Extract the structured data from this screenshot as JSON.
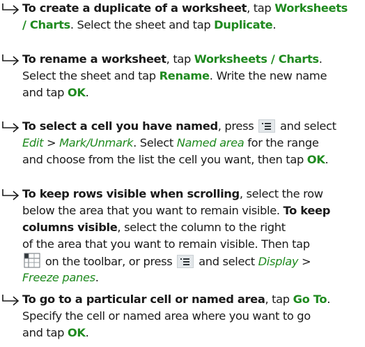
{
  "items": [
    {
      "lines": [
        [
          {
            "t": "To create a duplicate of a worksheet",
            "s": "b"
          },
          {
            "t": ", tap "
          },
          {
            "t": "Worksheets",
            "s": "g"
          }
        ],
        [
          {
            "t": "/ Charts",
            "s": "g"
          },
          {
            "t": ". Select the sheet and tap "
          },
          {
            "t": "Duplicate",
            "s": "g"
          },
          {
            "t": "."
          }
        ]
      ]
    },
    {
      "lines": [
        [
          {
            "t": "To rename a worksheet",
            "s": "b"
          },
          {
            "t": ", tap "
          },
          {
            "t": "Worksheets / Charts",
            "s": "g"
          },
          {
            "t": "."
          }
        ],
        [
          {
            "t": "Select the sheet and tap "
          },
          {
            "t": "Rename",
            "s": "g"
          },
          {
            "t": ". Write the new name"
          }
        ],
        [
          {
            "t": "and tap "
          },
          {
            "t": "OK",
            "s": "g"
          },
          {
            "t": "."
          }
        ]
      ]
    },
    {
      "lines": [
        [
          {
            "t": "To select a cell you have named",
            "s": "b"
          },
          {
            "t": ", press "
          },
          {
            "icon": "menu-icon"
          },
          {
            "t": " and select"
          }
        ],
        [
          {
            "t": "Edit",
            "s": "gi"
          },
          {
            "t": " > "
          },
          {
            "t": "Mark/Unmark",
            "s": "gi"
          },
          {
            "t": ". Select "
          },
          {
            "t": "Named area",
            "s": "gi"
          },
          {
            "t": " for the range"
          }
        ],
        [
          {
            "t": "and choose from the list the cell you want, then tap "
          },
          {
            "t": "OK",
            "s": "g"
          },
          {
            "t": "."
          }
        ]
      ]
    },
    {
      "lines": [
        [
          {
            "t": "To keep rows visible when scrolling",
            "s": "b"
          },
          {
            "t": ", select the row"
          }
        ],
        [
          {
            "t": "below the area that you want to remain visible. "
          },
          {
            "t": "To keep",
            "s": "b"
          }
        ],
        [
          {
            "t": "columns visible",
            "s": "b"
          },
          {
            "t": ", select the column to the right"
          }
        ],
        [
          {
            "t": "of the area that you want to remain visible. Then tap"
          }
        ],
        [
          {
            "icon": "freeze-panes-icon"
          },
          {
            "t": " on the toolbar, or press "
          },
          {
            "icon": "menu-icon"
          },
          {
            "t": " and select "
          },
          {
            "t": "Display",
            "s": "gi"
          },
          {
            "t": " >"
          }
        ],
        [
          {
            "t": "Freeze panes",
            "s": "gi"
          },
          {
            "t": "."
          }
        ]
      ]
    },
    {
      "lines": [
        [
          {
            "t": "To go to a particular cell or named area",
            "s": "b"
          },
          {
            "t": ", tap "
          },
          {
            "t": "Go To",
            "s": "g"
          },
          {
            "t": "."
          }
        ],
        [
          {
            "t": "Specify the cell or named area where you want to go"
          }
        ],
        [
          {
            "t": "and tap "
          },
          {
            "t": "OK",
            "s": "g"
          },
          {
            "t": "."
          }
        ]
      ]
    }
  ],
  "colors": {
    "accent_green": "#1f8a1f",
    "body_text": "#1a1a1a"
  },
  "icons": [
    "arrow-bullet-icon",
    "menu-icon",
    "freeze-panes-icon"
  ]
}
